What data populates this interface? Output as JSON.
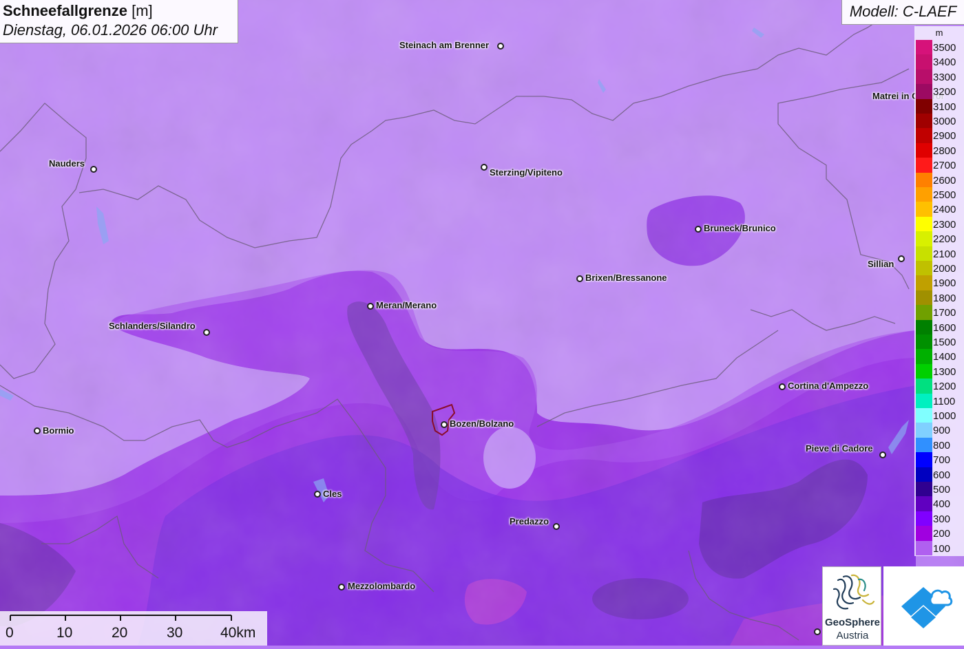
{
  "title": {
    "label": "Schneefallgrenze",
    "unit": "[m]",
    "datetime": "Dienstag, 06.01.2026 06:00 Uhr"
  },
  "model": "Modell: C-LAEF",
  "legend": {
    "unit": "m",
    "entries": [
      {
        "label": "3500",
        "color": "#d6127a"
      },
      {
        "label": "3400",
        "color": "#c8106f"
      },
      {
        "label": "3300",
        "color": "#b80e6a"
      },
      {
        "label": "3200",
        "color": "#9c0a62"
      },
      {
        "label": "3100",
        "color": "#800000"
      },
      {
        "label": "3000",
        "color": "#a00000"
      },
      {
        "label": "2900",
        "color": "#c00000"
      },
      {
        "label": "2800",
        "color": "#e00000"
      },
      {
        "label": "2700",
        "color": "#ff1a1a"
      },
      {
        "label": "2600",
        "color": "#ff8000"
      },
      {
        "label": "2500",
        "color": "#ffa000"
      },
      {
        "label": "2400",
        "color": "#ffc000"
      },
      {
        "label": "2300",
        "color": "#ffff00"
      },
      {
        "label": "2200",
        "color": "#d8f000"
      },
      {
        "label": "2100",
        "color": "#c8e000"
      },
      {
        "label": "2000",
        "color": "#c0c000"
      },
      {
        "label": "1900",
        "color": "#c0a000"
      },
      {
        "label": "1800",
        "color": "#a09000"
      },
      {
        "label": "1700",
        "color": "#70a000"
      },
      {
        "label": "1600",
        "color": "#008000"
      },
      {
        "label": "1500",
        "color": "#009000"
      },
      {
        "label": "1400",
        "color": "#00b000"
      },
      {
        "label": "1300",
        "color": "#00d000"
      },
      {
        "label": "1200",
        "color": "#00e080"
      },
      {
        "label": "1100",
        "color": "#00f0c0"
      },
      {
        "label": "1000",
        "color": "#80ffff"
      },
      {
        "label": "900",
        "color": "#80d0ff"
      },
      {
        "label": "800",
        "color": "#3090ff"
      },
      {
        "label": "700",
        "color": "#0000ff"
      },
      {
        "label": "600",
        "color": "#0000c0"
      },
      {
        "label": "500",
        "color": "#300090"
      },
      {
        "label": "400",
        "color": "#6000c0"
      },
      {
        "label": "300",
        "color": "#8000ff"
      },
      {
        "label": "200",
        "color": "#a000e0"
      },
      {
        "label": "100",
        "color": "#b060f0"
      }
    ]
  },
  "cities": [
    {
      "name": "Steinach am Brenner"
    },
    {
      "name": "Matrei in Osttirol"
    },
    {
      "name": "Nauders"
    },
    {
      "name": "Sterzing/Vipiteno"
    },
    {
      "name": "Bruneck/Brunico"
    },
    {
      "name": "Sillian"
    },
    {
      "name": "Brixen/Bressanone"
    },
    {
      "name": "Meran/Merano"
    },
    {
      "name": "Schlanders/Silandro"
    },
    {
      "name": "Cortina d'Ampezzo"
    },
    {
      "name": "Bormio"
    },
    {
      "name": "Bozen/Bolzano"
    },
    {
      "name": "Pieve di Cadore"
    },
    {
      "name": "Cles"
    },
    {
      "name": "Predazzo"
    },
    {
      "name": "Mezzolombardo"
    }
  ],
  "scale": {
    "labels": [
      "0",
      "10",
      "20",
      "30",
      "40km"
    ]
  },
  "logos": {
    "geosphere_line1": "GeoSphere",
    "geosphere_line2": "Austria"
  }
}
